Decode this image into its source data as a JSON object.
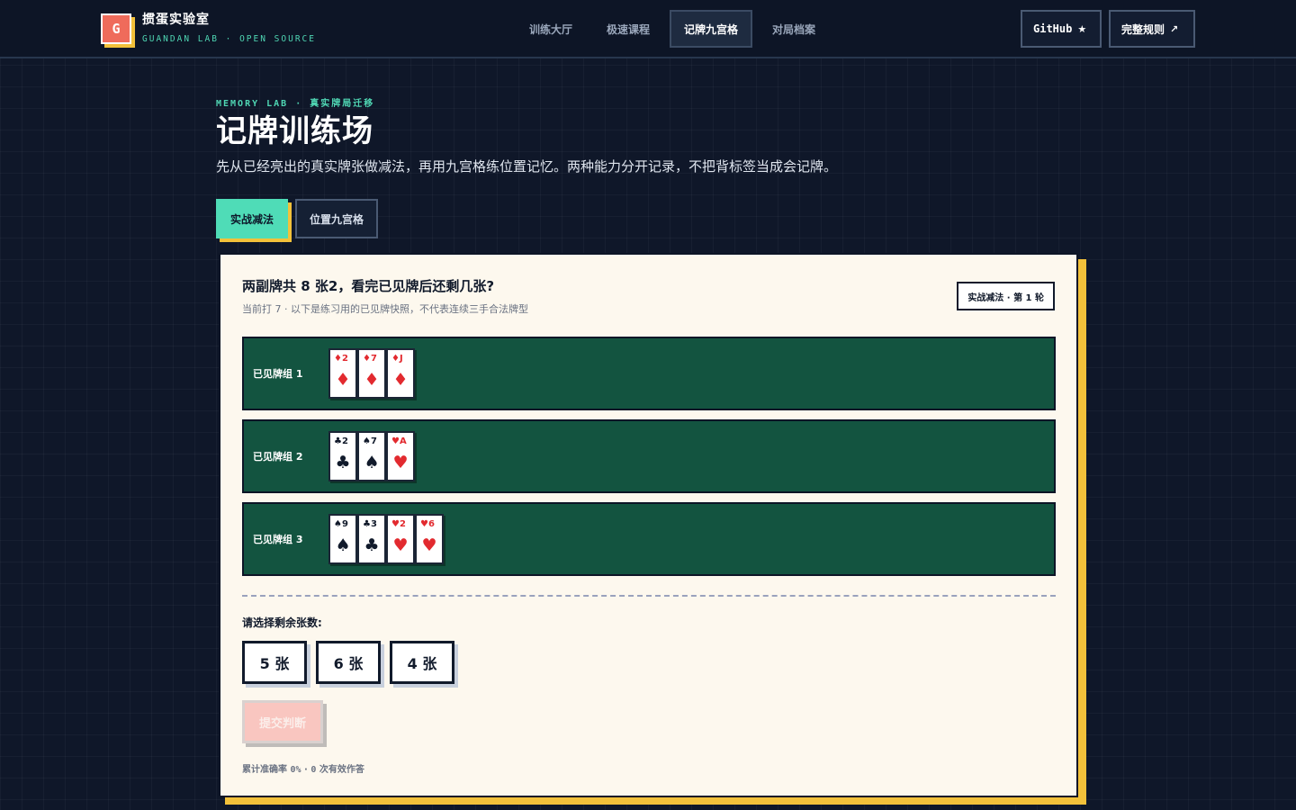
{
  "brand": {
    "logo_letter": "G",
    "title": "掼蛋实验室",
    "subtitle": "GUANDAN LAB · OPEN SOURCE"
  },
  "nav": {
    "items": [
      {
        "label": "训练大厅"
      },
      {
        "label": "极速课程"
      },
      {
        "label": "记牌九宫格",
        "active": true
      },
      {
        "label": "对局档案"
      }
    ]
  },
  "top_buttons": {
    "github": {
      "label": "GitHub",
      "glyph": "★"
    },
    "rules": {
      "label": "完整规则",
      "glyph": "↗"
    }
  },
  "hero": {
    "eyebrow": "MEMORY LAB · 真实牌局迁移",
    "title": "记牌训练场",
    "subtitle": "先从已经亮出的真实牌张做减法，再用九宫格练位置记忆。两种能力分开记录，不把背标签当成会记牌。"
  },
  "mode_tabs": [
    {
      "label": "实战减法",
      "active": true
    },
    {
      "label": "位置九宫格",
      "active": false
    }
  ],
  "question": {
    "title": "两副牌共 8 张2，看完已见牌后还剩几张?",
    "hint": "当前打 7 · 以下是练习用的已见牌快照，不代表连续三手合法牌型",
    "round_badge": "实战减法 · 第 1 轮"
  },
  "groups": [
    {
      "label": "已见牌组 1",
      "cards": [
        {
          "rank": "2",
          "suit": "♦",
          "color": "red"
        },
        {
          "rank": "7",
          "suit": "♦",
          "color": "red"
        },
        {
          "rank": "J",
          "suit": "♦",
          "color": "red"
        }
      ]
    },
    {
      "label": "已见牌组 2",
      "cards": [
        {
          "rank": "2",
          "suit": "♣",
          "color": "black"
        },
        {
          "rank": "7",
          "suit": "♠",
          "color": "black"
        },
        {
          "rank": "A",
          "suit": "♥",
          "color": "red"
        }
      ]
    },
    {
      "label": "已见牌组 3",
      "cards": [
        {
          "rank": "9",
          "suit": "♠",
          "color": "black"
        },
        {
          "rank": "3",
          "suit": "♣",
          "color": "black"
        },
        {
          "rank": "2",
          "suit": "♥",
          "color": "red"
        },
        {
          "rank": "6",
          "suit": "♥",
          "color": "red"
        }
      ]
    }
  ],
  "answer": {
    "prompt": "请选择剩余张数:",
    "options": [
      "5 张",
      "6 张",
      "4 张"
    ],
    "submit_label": "提交判断"
  },
  "stats": {
    "prefix": "累计准确率",
    "accuracy": "0%",
    "separator": "·",
    "answered": "0",
    "suffix": "次有效作答"
  },
  "colors": {
    "background": "#0f1729",
    "accent_teal": "#4fdcb7",
    "accent_yellow": "#f3c13a",
    "table_green": "#135440",
    "card_red": "#e22a2f",
    "logo_red": "#ef6b5b"
  }
}
